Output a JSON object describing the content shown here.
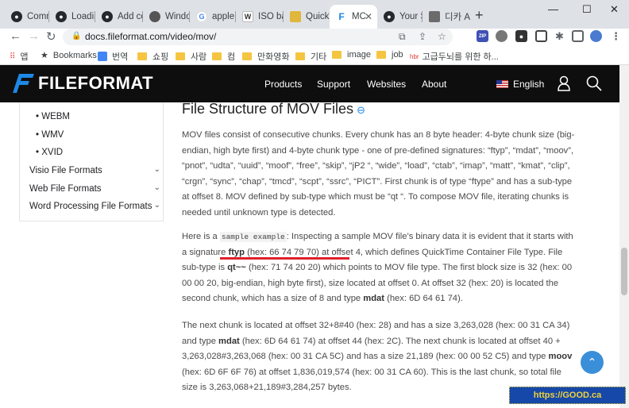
{
  "tabs": [
    {
      "label": "Comm",
      "icon": "github-icon",
      "color": "#24292e"
    },
    {
      "label": "Loadin",
      "icon": "github-icon",
      "color": "#24292e"
    },
    {
      "label": "Add co",
      "icon": "github-icon",
      "color": "#24292e"
    },
    {
      "label": "Windo",
      "icon": "apple-icon",
      "color": "#555555"
    },
    {
      "label": "apple",
      "icon": "google-icon",
      "color": "#4285f4"
    },
    {
      "label": "ISO ba",
      "icon": "wikipedia-icon",
      "color": "#333333"
    },
    {
      "label": "QuickT",
      "icon": "bookmark-icon",
      "color": "#e0b73a"
    },
    {
      "label": "MC",
      "icon": "fileformat-icon",
      "color": "#1e88e5",
      "active": true
    },
    {
      "label": "Your S",
      "icon": "github-icon",
      "color": "#24292e"
    },
    {
      "label": "디카 A",
      "icon": "page-icon",
      "color": "#6b6b6b"
    }
  ],
  "window": {
    "minimize": "—",
    "maximize": "☐",
    "close": "✕",
    "new_tab": "+"
  },
  "address_bar": {
    "url": "docs.fileformat.com/video/mov/"
  },
  "bookmarks": {
    "apps": "앱",
    "items": [
      "Bookmarks",
      "번역",
      "쇼핑",
      "사람",
      "컴",
      "만화영화",
      "기타",
      "image",
      "job",
      "고급두뇌를 위한 하..."
    ]
  },
  "site": {
    "logo": "FILEFORMAT",
    "nav": [
      "Products",
      "Support",
      "Websites",
      "About"
    ],
    "language": "English"
  },
  "sidebar": {
    "sub_items": [
      "WEBM",
      "WMV",
      "XVID"
    ],
    "sections": [
      "Visio File Formats",
      "Web File Formats",
      "Word Processing File Formats"
    ]
  },
  "main": {
    "heading": "File Structure of MOV Files",
    "p1": "MOV files consist of consecutive chunks. Every chunk has an 8 byte header: 4-byte chunk size (big-endian, high byte first) and 4-byte chunk type - one of pre-defined signatures: “ftyp”, “mdat”, “moov”, “pnot”, “udta”, “uuid”, “moof”, “free”, “skip”, “jP2 “, “wide”, “load”, “ctab”, “imap”, “matt”, “kmat”, “clip”, “crgn”, “sync”, “chap”, “tmcd”, “scpt”, “ssrc”, “PICT”. First chunk is of type “ftype” and has a sub-type at offset 8. MOV defined by sub-type which must be “qt “. To compose MOV file, iterating chunks is needed until unknown type is detected.",
    "p2": {
      "t1": "Here is a ",
      "code": "sample example",
      "t2": ": Inspecting a sample MOV file’s binary data it is evident that it starts with a signature ",
      "b1": "ftyp",
      "t3": " (hex: 66 74 79 70) at offset 4, which defines QuickTime Container File Type. File sub-type is ",
      "b2": "qt~~",
      "t4": " (hex: 71 74 20 20) which points to MOV file type. The first block size is 32 (hex: 00 00 00 20, big-endian, high byte first), size located at offset 0. At offset 32 (hex: 20) is located the second chunk, which has a size of 8 and type ",
      "b3": "mdat",
      "t5": " (hex: 6D 64 61 74)."
    },
    "p3": {
      "t1": "The next chunk is located at offset 32+8#40 (hex: 28) and has a size 3,263,028 (hex: 00 31 CA 34) and type ",
      "b1": "mdat",
      "t2": " (hex: 6D 64 61 74) at offset 44 (hex: 2C). The next chunk is located at offset 40 + 3,263,028#3,263,068 (hex: 00 31 CA 5C) and has a size 21,189 (hex: 00 00 52 C5) and type ",
      "b2": "moov",
      "t3": " (hex: 6D 6F 6F 76) at offset 1,836,019,574 (hex: 00 31 CA 60). This is the last chunk, so total file size is 3,263,068+21,189#3,284,257 bytes."
    }
  },
  "watermark": "https://GOOD.ca",
  "colors": {
    "accent": "#1e88e5",
    "header_bg": "#0e0e0e",
    "underline": "#e0202a",
    "fab": "#3b8fd9"
  }
}
